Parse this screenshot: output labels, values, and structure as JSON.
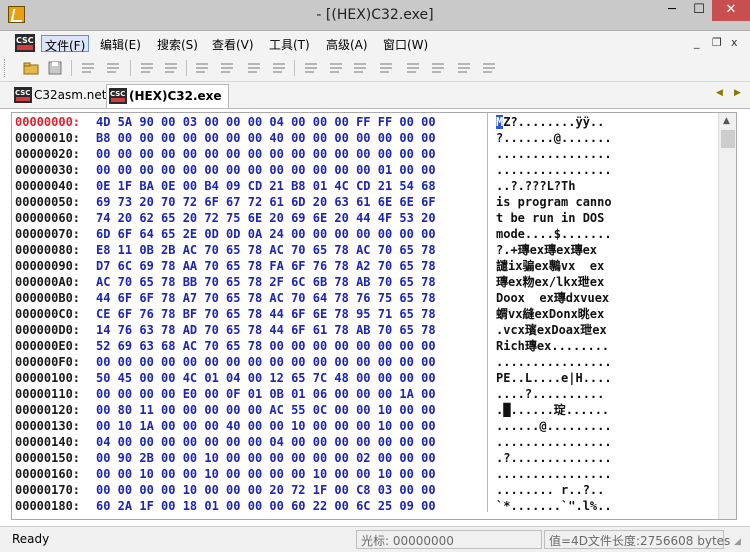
{
  "window": {
    "title": "- [(HEX)C32.exe]",
    "min_glyph": "─",
    "max_glyph": "☐",
    "close_glyph": "✕",
    "mdi_minimize": "_",
    "mdi_restore": "❐",
    "mdi_close": "x"
  },
  "menu": [
    {
      "label": "文件(F)",
      "active": true
    },
    {
      "label": "编辑(E)",
      "active": false
    },
    {
      "label": "搜索(S)",
      "active": false
    },
    {
      "label": "查看(V)",
      "active": false
    },
    {
      "label": "工具(T)",
      "active": false
    },
    {
      "label": "高级(A)",
      "active": false
    },
    {
      "label": "窗口(W)",
      "active": false
    }
  ],
  "toolbar": [
    {
      "name": "open-file-icon"
    },
    {
      "name": "save-icon"
    },
    {
      "name": "copy-icon"
    },
    {
      "name": "paste-icon"
    },
    {
      "name": "back-arrow-icon"
    },
    {
      "name": "forward-arrow-icon"
    },
    {
      "name": "edit-icon"
    },
    {
      "name": "insert-icon"
    },
    {
      "name": "fill-icon"
    },
    {
      "name": "replace-icon"
    },
    {
      "name": "settings-icon"
    },
    {
      "name": "align-left-icon"
    },
    {
      "name": "align-center-icon"
    },
    {
      "name": "block-icon"
    },
    {
      "name": "grid-icon"
    },
    {
      "name": "wrench-icon"
    },
    {
      "name": "window-icon"
    },
    {
      "name": "table-icon"
    }
  ],
  "tabs": [
    {
      "label": "C32asm.net",
      "active": false
    },
    {
      "label": "(HEX)C32.exe",
      "active": true
    }
  ],
  "colors": {
    "accent": "#1c25b4",
    "address_current": "#e0202f",
    "close_button": "#c74f4f"
  },
  "hex_rows": [
    {
      "addr": "00000000:",
      "hex": "4D 5A 90 00 03 00 00 00 04 00 00 00 FF FF 00 00",
      "ascii": "MZ?........ÿÿ..",
      "current": true
    },
    {
      "addr": "00000010:",
      "hex": "B8 00 00 00 00 00 00 00 40 00 00 00 00 00 00 00",
      "ascii": "?.......@......."
    },
    {
      "addr": "00000020:",
      "hex": "00 00 00 00 00 00 00 00 00 00 00 00 00 00 00 00",
      "ascii": "................"
    },
    {
      "addr": "00000030:",
      "hex": "00 00 00 00 00 00 00 00 00 00 00 00 00 01 00 00",
      "ascii": "................"
    },
    {
      "addr": "00000040:",
      "hex": "0E 1F BA 0E 00 B4 09 CD 21 B8 01 4C CD 21 54 68",
      "ascii": "..?.???L?Th"
    },
    {
      "addr": "00000050:",
      "hex": "69 73 20 70 72 6F 67 72 61 6D 20 63 61 6E 6E 6F",
      "ascii": "is program canno"
    },
    {
      "addr": "00000060:",
      "hex": "74 20 62 65 20 72 75 6E 20 69 6E 20 44 4F 53 20",
      "ascii": "t be run in DOS "
    },
    {
      "addr": "00000070:",
      "hex": "6D 6F 64 65 2E 0D 0D 0A 24 00 00 00 00 00 00 00",
      "ascii": "mode....$......."
    },
    {
      "addr": "00000080:",
      "hex": "E8 11 0B 2B AC 70 65 78 AC 70 65 78 AC 70 65 78",
      "ascii": "?.+瑼ex瑼ex瑼ex"
    },
    {
      "addr": "00000090:",
      "hex": "D7 6C 69 78 AA 70 65 78 FA 6F 76 78 A2 70 65 78",
      "ascii": "譴ix骗ex鷒vx  ex"
    },
    {
      "addr": "000000A0:",
      "hex": "AC 70 65 78 BB 70 65 78 2F 6C 6B 78 AB 70 65 78",
      "ascii": "瑼ex粅ex/lkx玴ex"
    },
    {
      "addr": "000000B0:",
      "hex": "44 6F 6F 78 A7 70 65 78 AC 70 64 78 76 75 65 78",
      "ascii": "Doox  ex瑼dxvuex"
    },
    {
      "addr": "000000C0:",
      "hex": "CE 6F 76 78 BF 70 65 78 44 6F 6E 78 95 71 65 78",
      "ascii": "蝟vx縫exDonx晀ex"
    },
    {
      "addr": "000000D0:",
      "hex": "14 76 63 78 AD 70 65 78 44 6F 61 78 AB 70 65 78",
      "ascii": ".vcx璸exDoax玴ex"
    },
    {
      "addr": "000000E0:",
      "hex": "52 69 63 68 AC 70 65 78 00 00 00 00 00 00 00 00",
      "ascii": "Rich瑼ex........"
    },
    {
      "addr": "000000F0:",
      "hex": "00 00 00 00 00 00 00 00 00 00 00 00 00 00 00 00",
      "ascii": "................"
    },
    {
      "addr": "00000100:",
      "hex": "50 45 00 00 4C 01 04 00 12 65 7C 48 00 00 00 00",
      "ascii": "PE..L....e|H...."
    },
    {
      "addr": "00000110:",
      "hex": "00 00 00 00 E0 00 0F 01 0B 01 06 00 00 00 1A 00",
      "ascii": "....?.........."
    },
    {
      "addr": "00000120:",
      "hex": "00 80 11 00 00 00 00 00 AC 55 0C 00 00 10 00 00",
      "ascii": ".█......琔......"
    },
    {
      "addr": "00000130:",
      "hex": "00 10 1A 00 00 00 40 00 00 10 00 00 00 10 00 00",
      "ascii": "......@........."
    },
    {
      "addr": "00000140:",
      "hex": "04 00 00 00 00 00 00 00 04 00 00 00 00 00 00 00",
      "ascii": "................"
    },
    {
      "addr": "00000150:",
      "hex": "00 90 2B 00 00 10 00 00 00 00 00 00 02 00 00 00",
      "ascii": ".?.............."
    },
    {
      "addr": "00000160:",
      "hex": "00 00 10 00 00 10 00 00 00 00 10 00 00 10 00 00",
      "ascii": "................"
    },
    {
      "addr": "00000170:",
      "hex": "00 00 00 00 10 00 00 00 20 72 1F 00 C8 03 00 00",
      "ascii": "........ r..?.."
    },
    {
      "addr": "00000180:",
      "hex": "60 2A 1F 00 18 01 00 00 00 60 22 00 6C 25 09 00",
      "ascii": "`*.......`\".l%.."
    }
  ],
  "status": {
    "ready": "Ready",
    "cursor_label": "光标: 00000000",
    "value_label": "值=4D文件长度:2756608 bytes"
  }
}
